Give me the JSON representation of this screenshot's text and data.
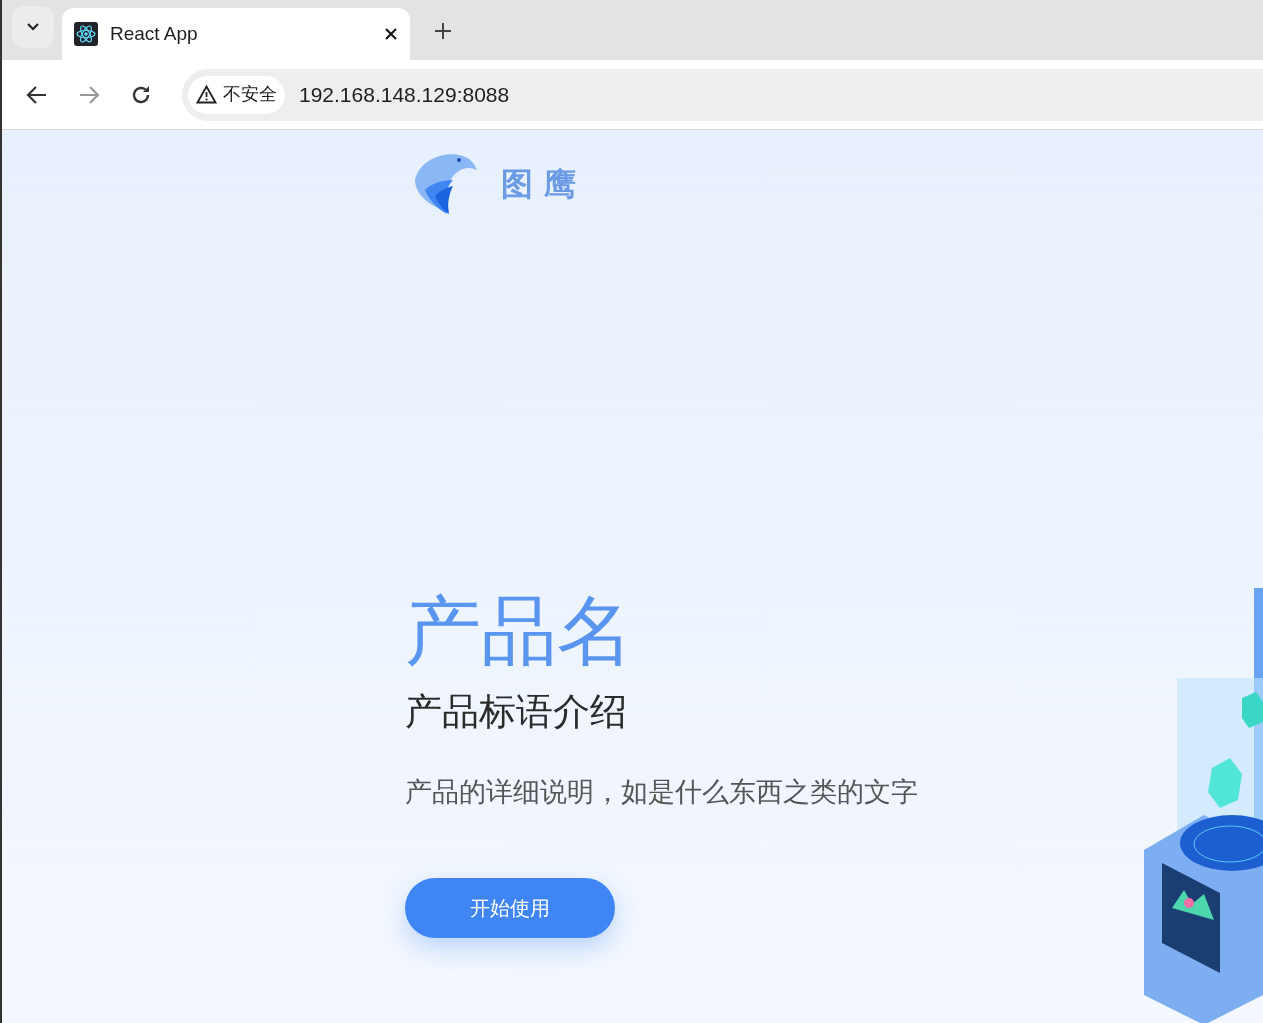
{
  "browser": {
    "tab_title": "React App",
    "security_label": "不安全",
    "address": "192.168.148.129:8088"
  },
  "header": {
    "logo_text": "图 鹰"
  },
  "hero": {
    "title": "产品名",
    "slogan": "产品标语介绍",
    "description": "产品的详细说明，如是什么东西之类的文字",
    "button": "开始使用"
  }
}
